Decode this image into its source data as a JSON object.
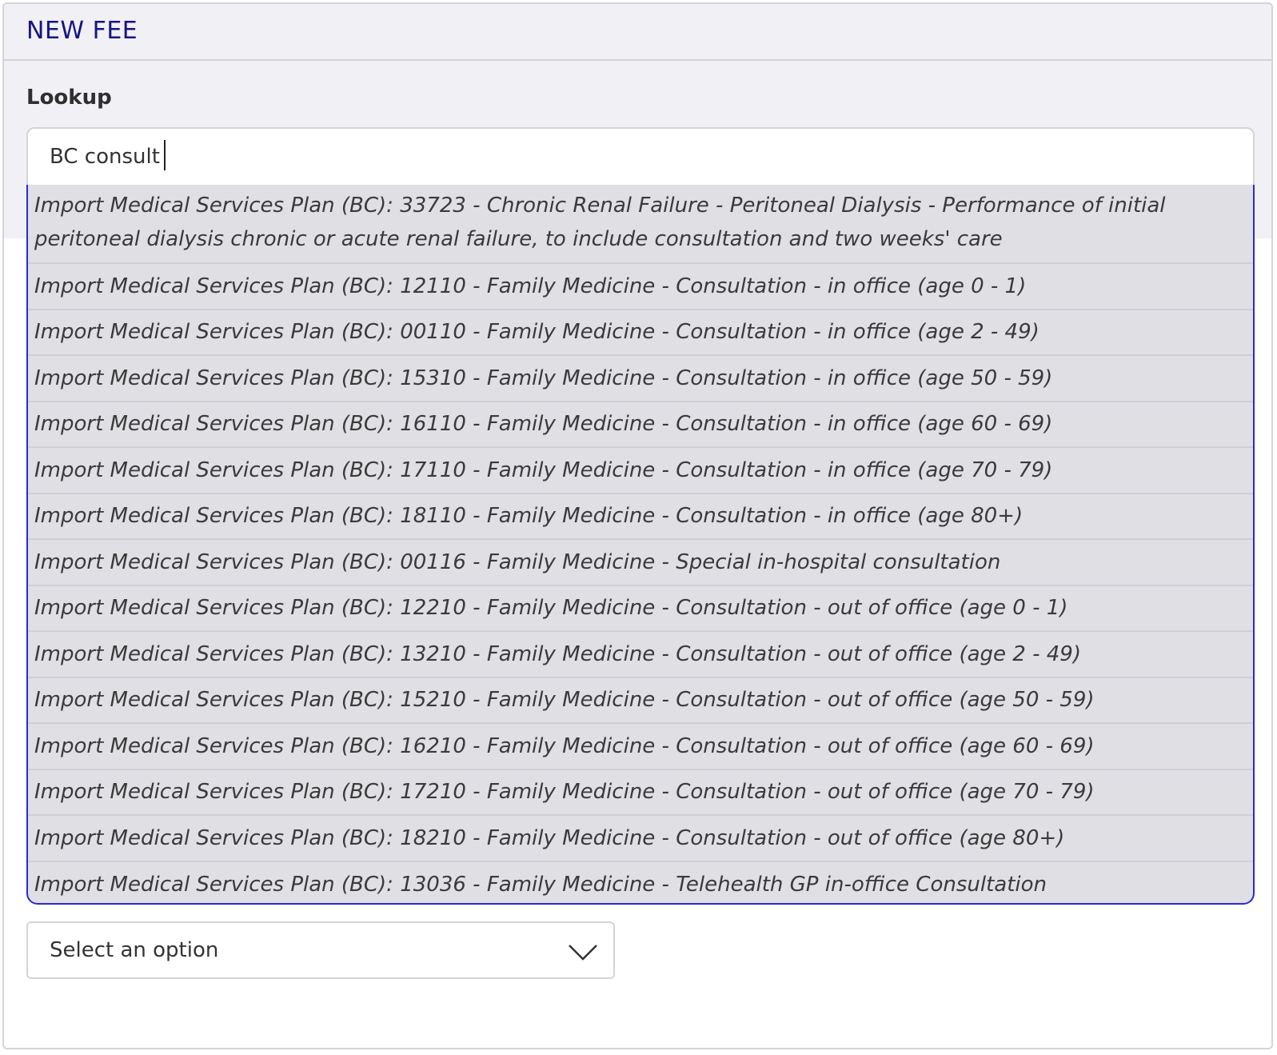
{
  "panel": {
    "title": "NEW FEE"
  },
  "lookup": {
    "label": "Lookup",
    "value": "BC consult",
    "options": [
      "Import Medical Services Plan (BC): 33723 - Chronic Renal Failure - Peritoneal Dialysis - Performance of initial peritoneal dialysis chronic or acute renal failure, to include consultation and two weeks' care",
      "Import Medical Services Plan (BC): 12110 - Family Medicine - Consultation - in office (age 0 - 1)",
      "Import Medical Services Plan (BC): 00110 - Family Medicine - Consultation - in office (age 2 - 49)",
      "Import Medical Services Plan (BC): 15310 - Family Medicine - Consultation - in office (age 50 - 59)",
      "Import Medical Services Plan (BC): 16110 - Family Medicine - Consultation - in office (age 60 - 69)",
      "Import Medical Services Plan (BC): 17110 - Family Medicine - Consultation - in office (age 70 - 79)",
      "Import Medical Services Plan (BC): 18110 - Family Medicine - Consultation - in office (age 80+)",
      "Import Medical Services Plan (BC): 00116 - Family Medicine - Special in-hospital consultation",
      "Import Medical Services Plan (BC): 12210 - Family Medicine - Consultation - out of office (age 0 - 1)",
      "Import Medical Services Plan (BC): 13210 - Family Medicine - Consultation - out of office (age 2 - 49)",
      "Import Medical Services Plan (BC): 15210 - Family Medicine - Consultation - out of office (age 50 - 59)",
      "Import Medical Services Plan (BC): 16210 - Family Medicine - Consultation - out of office (age 60 - 69)",
      "Import Medical Services Plan (BC): 17210 - Family Medicine - Consultation - out of office (age 70 - 79)",
      "Import Medical Services Plan (BC): 18210 - Family Medicine - Consultation - out of office (age 80+)",
      "Import Medical Services Plan (BC): 13036 - Family Medicine - Telehealth GP in-office Consultation"
    ]
  },
  "select": {
    "value": "Select an option",
    "icon": "chevron-down-icon"
  },
  "colors": {
    "title": "#161680",
    "dropdown_border": "#2a2ad0",
    "dropdown_bg": "#dfdfe4",
    "header_bg": "#f1f0f5"
  }
}
